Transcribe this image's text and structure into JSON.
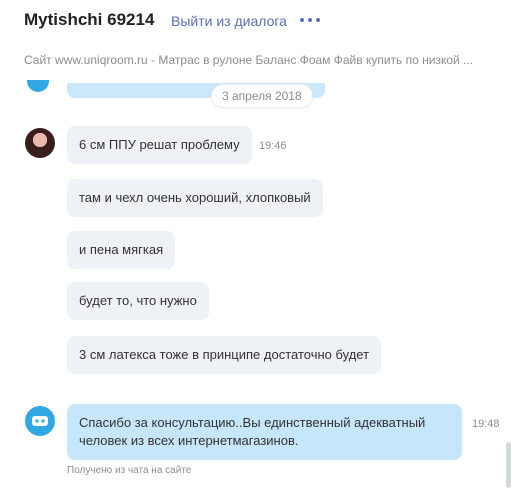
{
  "header": {
    "title": "Mytishchi 69214",
    "leave_link": "Выйти из диалога",
    "more_icon": "more-horizontal-icon"
  },
  "subtitle": "Сайт www.uniqroom.ru - Матрас в рулоне Баланс Фоам Файв купить по низкой ...",
  "date_separator": "3 апреля 2018",
  "messages": [
    {
      "text": "6 см ППУ решат проблему",
      "time": "19:46"
    },
    {
      "text": "там и чехл очень хороший, хлопковый"
    },
    {
      "text": "и пена мягкая"
    },
    {
      "text": "будет то, что нужно"
    },
    {
      "text": "3 см латекса тоже в принципе достаточно будет"
    }
  ],
  "reply": {
    "text": "Спасибо за консультацию..Вы единственный адекватный человек из всех интернетмагазинов.",
    "time": "19:48",
    "caption": "Получено из чата на сайте",
    "avatar_icon": "chat-bot-icon"
  },
  "colors": {
    "accent": "#5a6fb7",
    "incoming_bubble": "#eef1f6",
    "outgoing_bubble": "#c6e6fb",
    "bot_avatar": "#33a7e4"
  }
}
